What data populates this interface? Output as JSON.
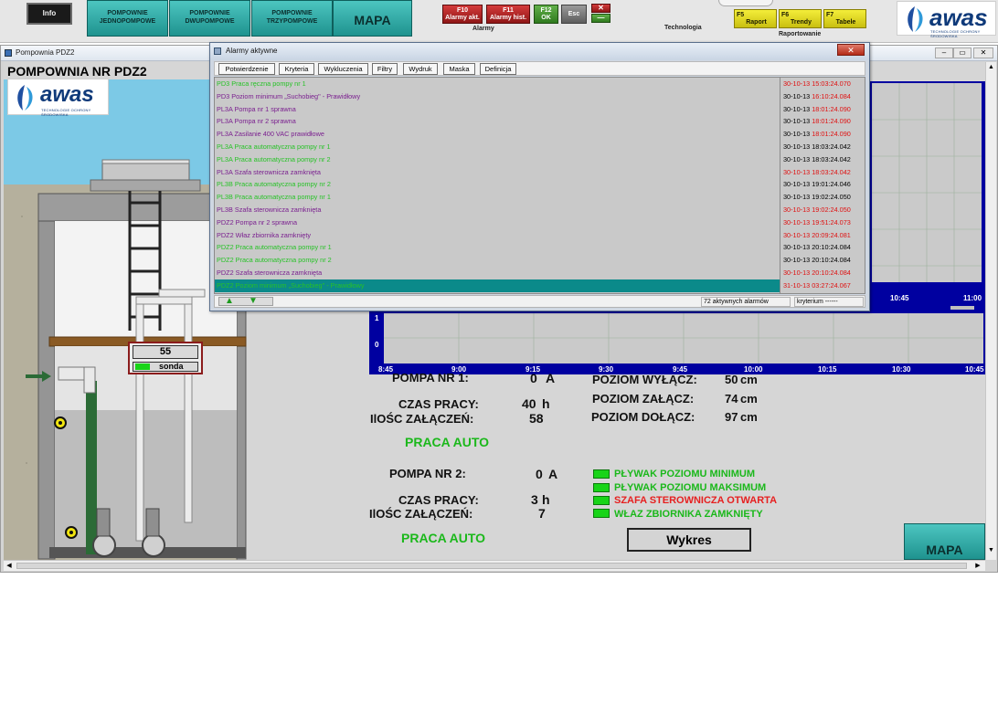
{
  "toolbar": {
    "info_label": "Info",
    "btn_jedno": "POMPOWNIE JEDNOPOMPOWE",
    "btn_dwu": "POMPOWNIE DWUPOMPOWE",
    "btn_trzy": "POMPOWNIE TRZYPOMPOWE",
    "btn_mapa": "MAPA",
    "alarmy_akt_key": "F10",
    "alarmy_akt": "Alarmy akt.",
    "alarmy_hist_key": "F11",
    "alarmy_hist": "Alarmy hist.",
    "ok_key": "F12",
    "ok": "OK",
    "esc": "Esc",
    "group_alarmy": "Alarmy",
    "group_technologia": "Technologia",
    "raport_key": "F5",
    "raport": "Raport",
    "trendy_key": "F6",
    "trendy": "Trendy",
    "tabele_key": "F7",
    "tabele": "Tabele",
    "group_raportowanie": "Raportowanie"
  },
  "logo": {
    "text": "awas",
    "subtitle": "TECHNOLOGIE OCHRONY ŚRODOWISKA"
  },
  "window": {
    "title": "Pompownia PDZ2",
    "heading": "POMPOWNIA NR PDZ2"
  },
  "pump_scene": {
    "level_value": "55",
    "sensor_label": "sonda"
  },
  "alarm_dialog": {
    "title": "Alarmy aktywne",
    "buttons": [
      "Potwierdzenie",
      "Kryteria",
      "Wykluczenia",
      "Filtry",
      "Wydruk",
      "Maska",
      "Definicja"
    ],
    "rows": [
      {
        "text": "PD3 Praca ręczna pompy nr 1",
        "date": "30-10-13",
        "time": "15:03:24.070"
      },
      {
        "text": "PD3 Poziom minimum „Suchobieg\" - Prawidłowy",
        "date": "30-10-13",
        "time": "16:10:24.084"
      },
      {
        "text": "PL3A Pompa nr 1 sprawna",
        "date": "30-10-13",
        "time": "18:01:24.090"
      },
      {
        "text": "PL3A Pompa nr 2 sprawna",
        "date": "30-10-13",
        "time": "18:01:24.090"
      },
      {
        "text": "PL3A Zasilanie 400 VAC prawidłowe",
        "date": "30-10-13",
        "time": "18:01:24.090"
      },
      {
        "text": "PL3A Praca automatyczna pompy nr 1",
        "date": "30-10-13",
        "time": "18:03:24.042"
      },
      {
        "text": "PL3A Praca automatyczna pompy nr 2",
        "date": "30-10-13",
        "time": "18:03:24.042"
      },
      {
        "text": "PL3A Szafa sterownicza zamknięta",
        "date": "30-10-13",
        "time": "18:03:24.042"
      },
      {
        "text": "PL3B Praca automatyczna pompy nr 2",
        "date": "30-10-13",
        "time": "19:01:24.046"
      },
      {
        "text": "PL3B Praca automatyczna pompy nr 1",
        "date": "30-10-13",
        "time": "19:02:24.050"
      },
      {
        "text": "PL3B Szafa sterownicza zamknięta",
        "date": "30-10-13",
        "time": "19:02:24.050"
      },
      {
        "text": "PDZ2 Pompa nr 2 sprawna",
        "date": "30-10-13",
        "time": "19:51:24.073"
      },
      {
        "text": "PDZ2 Właz zbiornika zamknięty",
        "date": "30-10-13",
        "time": "20:09:24.081"
      },
      {
        "text": "PDZ2 Praca automatyczna pompy nr 1",
        "date": "30-10-13",
        "time": "20:10:24.084"
      },
      {
        "text": "PDZ2 Praca automatyczna pompy nr 2",
        "date": "30-10-13",
        "time": "20:10:24.084"
      },
      {
        "text": "PDZ2 Szafa sterownicza zamknięta",
        "date": "30-10-13",
        "time": "20:10:24.084"
      },
      {
        "text": "PDZ2 Poziom minimum „Suchobieg\" - Prawidłowy",
        "date": "31-10-13",
        "time": "03:27:24.067"
      }
    ],
    "status_count": "72 aktywnych alarmów",
    "status_criteria": "kryterium ------"
  },
  "trend": {
    "top_ticks": [
      "10:45",
      "11:00"
    ],
    "bottom_ticks": [
      "8:45",
      "9:00",
      "9:15",
      "9:30",
      "9:45",
      "10:00",
      "10:15",
      "10:30",
      "10:45"
    ],
    "y_ticks": [
      "1",
      "0"
    ]
  },
  "pompa1": {
    "label": "POMPA NR 1:",
    "current": "0",
    "current_unit": "A",
    "czas_label": "CZAS PRACY:",
    "czas": "40",
    "czas_unit": "h",
    "zal_label": "IlOŚC ZAŁĄCZEŃ:",
    "zal": "58",
    "status": "PRACA AUTO"
  },
  "pompa2": {
    "label": "POMPA NR 2:",
    "current": "0",
    "current_unit": "A",
    "czas_label": "CZAS PRACY:",
    "czas": "3",
    "czas_unit": "h",
    "zal_label": "IlOŚC ZAŁĄCZEŃ:",
    "zal": "7",
    "status": "PRACA AUTO"
  },
  "levels": {
    "wylacz_label": "POZIOM WYŁĄCZ:",
    "wylacz": "50",
    "zalacz_label": "POZIOM ZAŁĄCZ:",
    "zalacz": "74",
    "dolacz_label": "POZIOM DOŁĄCZ:",
    "dolacz": "97",
    "unit": "cm"
  },
  "indicators": [
    {
      "label": "PŁYWAK POZIOMU MINIMUM",
      "color": "#1bb81b"
    },
    {
      "label": "PŁYWAK POZIOMU MAKSIMUM",
      "color": "#1bb81b"
    },
    {
      "label": "SZAFA STEROWNICZA OTWARTA",
      "color": "#e62020"
    },
    {
      "label": "WŁAZ ZBIORNIKA ZAMKNIĘTY",
      "color": "#1bb81b"
    }
  ],
  "buttons": {
    "wykres": "Wykres",
    "mapa": "MAPA"
  },
  "colors": {
    "green_row": "#27c227",
    "purple_row": "#7a1f8f",
    "red_time": "#e01010",
    "selected_row": "#0b8a8a"
  }
}
